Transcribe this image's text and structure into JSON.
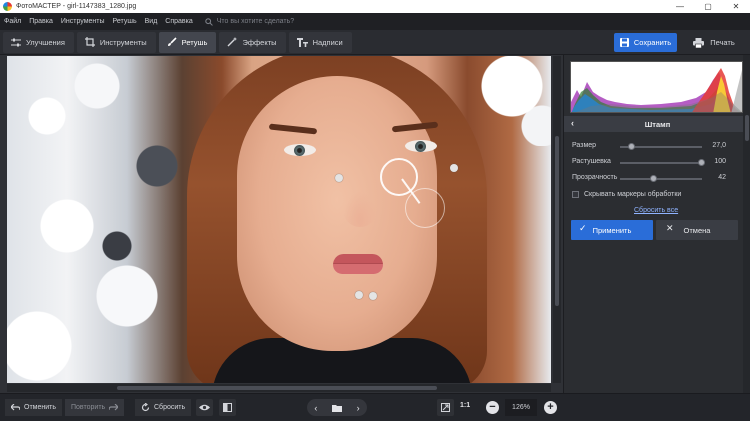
{
  "window": {
    "title": "ФотоМАСТЕР - girl-1147383_1280.jpg",
    "controls": [
      "—",
      "▢",
      "✕"
    ]
  },
  "menu": {
    "items": [
      "Файл",
      "Правка",
      "Инструменты",
      "Ретушь",
      "Вид",
      "Справка"
    ],
    "search_placeholder": "Что вы хотите сделать?"
  },
  "tabs": [
    {
      "label": "Улучшения",
      "icon": "sliders-icon"
    },
    {
      "label": "Инструменты",
      "icon": "crop-icon"
    },
    {
      "label": "Ретушь",
      "icon": "brush-icon",
      "active": true
    },
    {
      "label": "Эффекты",
      "icon": "magic-wand-icon"
    },
    {
      "label": "Надписи",
      "icon": "text-icon"
    }
  ],
  "toolbar": {
    "save_label": "Сохранить",
    "print_label": "Печать"
  },
  "panel": {
    "title": "Штамп",
    "sliders": [
      {
        "label": "Размер",
        "value": "27,0",
        "level": 0.15
      },
      {
        "label": "Растушевка",
        "value": "100",
        "level": 1.0
      },
      {
        "label": "Прозрачность",
        "value": "42",
        "level": 0.42
      }
    ],
    "hide_markers_label": "Скрывать маркеры обработки",
    "reset_all_label": "Сбросить все",
    "apply_label": "Применить",
    "cancel_label": "Отмена"
  },
  "bottom": {
    "undo_label": "Отменить",
    "redo_label": "Повторить",
    "reset_label": "Сбросить",
    "one_to_one": "1:1",
    "zoom_value": "126%"
  },
  "colors": {
    "accent": "#2a6dd8",
    "panel_bg": "#2b2d31",
    "bar_bg": "#1f2024"
  }
}
